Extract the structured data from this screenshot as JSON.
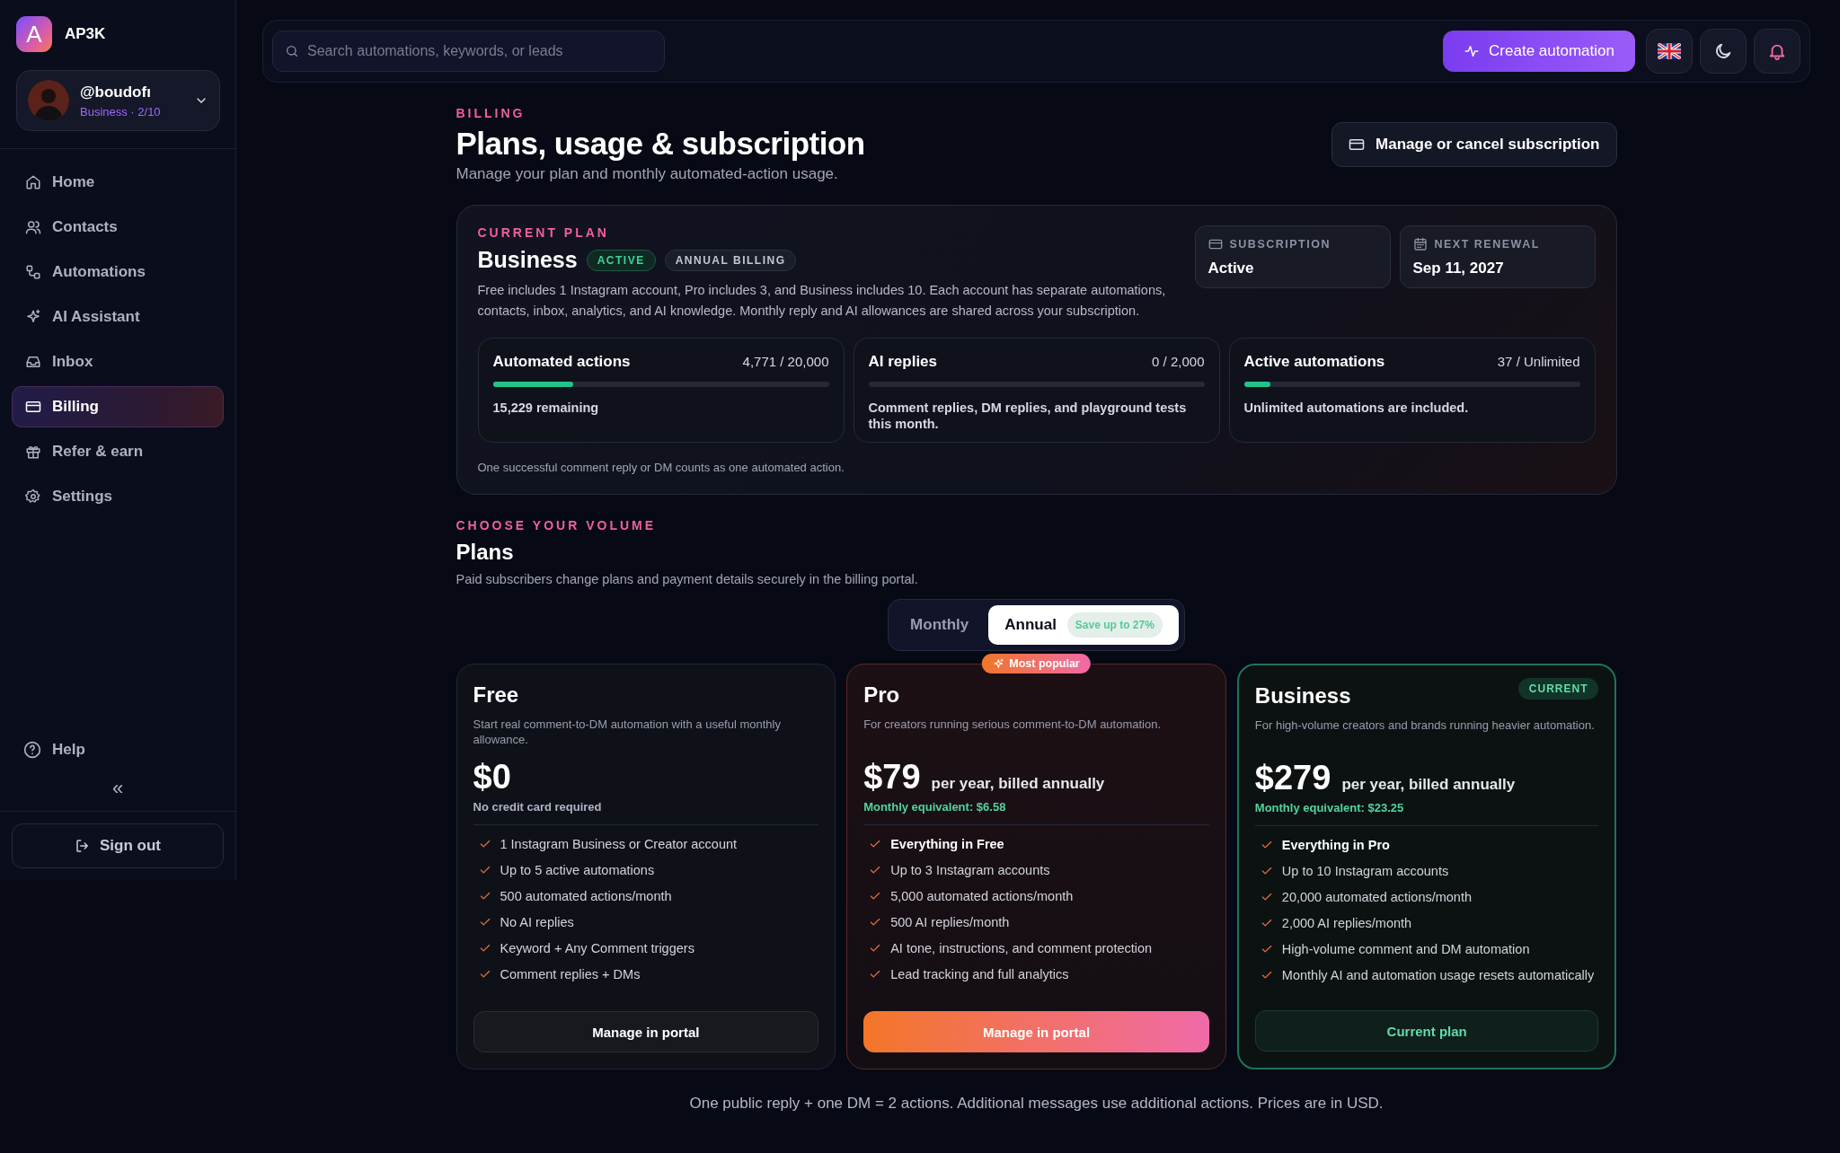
{
  "sidebar": {
    "brand": "AP3K",
    "logo_letter": "A",
    "user": {
      "handle": "@boudofı",
      "plan": "Business · 2/10"
    },
    "items": [
      {
        "label": "Home",
        "selected": false
      },
      {
        "label": "Contacts",
        "selected": false
      },
      {
        "label": "Automations",
        "selected": false
      },
      {
        "label": "AI Assistant",
        "selected": false
      },
      {
        "label": "Inbox",
        "selected": false
      },
      {
        "label": "Billing",
        "selected": true
      },
      {
        "label": "Refer & earn",
        "selected": false
      },
      {
        "label": "Settings",
        "selected": false
      }
    ],
    "help": "Help",
    "collapse": "«",
    "sign_out": "Sign out"
  },
  "topbar": {
    "search": {
      "placeholder": "Search automations, keywords, or leads"
    },
    "create_button": "Create automation"
  },
  "header": {
    "eyebrow": "BILLING",
    "title": "Plans, usage & subscription",
    "subtitle": "Manage your plan and monthly automated-action usage.",
    "manage_button": "Manage or cancel subscription"
  },
  "current_plan": {
    "eyebrow": "CURRENT PLAN",
    "name": "Business",
    "badges": [
      {
        "label": "ACTIVE",
        "kind": "success"
      },
      {
        "label": "ANNUAL BILLING",
        "kind": "neutral"
      }
    ],
    "description": "Free includes 1 Instagram account, Pro includes 3, and Business includes 10. Each account has separate automations, contacts, inbox, analytics, and AI knowledge. Monthly reply and AI allowances are shared across your subscription.",
    "info": [
      {
        "label": "SUBSCRIPTION",
        "value": "Active"
      },
      {
        "label": "NEXT RENEWAL",
        "value": "Sep 11, 2027"
      }
    ],
    "meters": [
      {
        "name": "Automated actions",
        "reading": "4,771 / 20,000",
        "level": 0.239,
        "note": "15,229 remaining"
      },
      {
        "name": "AI replies",
        "reading": "0 / 2,000",
        "level": 0,
        "note": "Comment replies, DM replies, and playground tests this month."
      },
      {
        "name": "Active automations",
        "reading": "37 / Unlimited",
        "level": 0.08,
        "note": "Unlimited automations are included."
      }
    ],
    "footnote": "One successful comment reply or DM counts as one automated action."
  },
  "plans_section": {
    "eyebrow": "CHOOSE YOUR VOLUME",
    "title": "Plans",
    "subtitle": "Paid subscribers change plans and payment details securely in the billing portal.",
    "billing_toggle": [
      {
        "label": "Monthly",
        "selected": false
      },
      {
        "label": "Annual",
        "selected": true,
        "badge": "Save up to 27%"
      }
    ],
    "plans": [
      {
        "name": "Free",
        "kind": "basic",
        "description": "Start real comment-to-DM automation with a useful monthly allowance.",
        "price": "$0",
        "note": "No credit card required",
        "features": [
          {
            "text": "1 Instagram Business or Creator account",
            "bold": false
          },
          {
            "text": "Up to 5 active automations",
            "bold": false
          },
          {
            "text": "500 automated actions/month",
            "bold": false
          },
          {
            "text": "No AI replies",
            "bold": false
          },
          {
            "text": "Keyword + Any Comment triggers",
            "bold": false
          },
          {
            "text": "Comment replies + DMs",
            "bold": false
          }
        ],
        "button": "Manage in portal"
      },
      {
        "name": "Pro",
        "kind": "featured",
        "ribbon": "Most popular",
        "description": "For creators running serious comment-to-DM automation.",
        "price": "$79",
        "period": "per year, billed annually",
        "equivalent": "Monthly equivalent: $6.58",
        "features": [
          {
            "text": "Everything in Free",
            "bold": true
          },
          {
            "text": "Up to 3 Instagram accounts",
            "bold": false
          },
          {
            "text": "5,000 automated actions/month",
            "bold": false
          },
          {
            "text": "500 AI replies/month",
            "bold": false
          },
          {
            "text": "AI tone, instructions, and comment protection",
            "bold": false
          },
          {
            "text": "Lead tracking and full analytics",
            "bold": false
          }
        ],
        "button": "Manage in portal"
      },
      {
        "name": "Business",
        "kind": "current",
        "tag": "CURRENT",
        "description": "For high-volume creators and brands running heavier automation.",
        "price": "$279",
        "period": "per year, billed annually",
        "equivalent": "Monthly equivalent: $23.25",
        "features": [
          {
            "text": "Everything in Pro",
            "bold": true
          },
          {
            "text": "Up to 10 Instagram accounts",
            "bold": false
          },
          {
            "text": "20,000 automated actions/month",
            "bold": false
          },
          {
            "text": "2,000 AI replies/month",
            "bold": false
          },
          {
            "text": "High-volume comment and DM automation",
            "bold": false
          },
          {
            "text": "Monthly AI and automation usage resets automatically",
            "bold": false
          }
        ],
        "button": "Current plan"
      }
    ],
    "footer": "One public reply + one DM = 2 actions. Additional messages use additional actions. Prices are in USD."
  }
}
